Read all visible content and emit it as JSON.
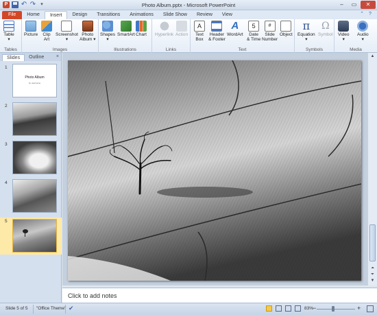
{
  "window": {
    "title": "Photo Album.pptx - Microsoft PowerPoint",
    "app_icon_letter": "P"
  },
  "tabs": [
    "File",
    "Home",
    "Insert",
    "Design",
    "Transitions",
    "Animations",
    "Slide Show",
    "Review",
    "View"
  ],
  "active_tab": "Insert",
  "ribbon": {
    "tables_group": {
      "label": "Tables",
      "table": "Table"
    },
    "images_group": {
      "label": "Images",
      "picture": "Picture",
      "clip_art_1": "Clip",
      "clip_art_2": "Art",
      "screenshot": "Screenshot",
      "photo_album_1": "Photo",
      "photo_album_2": "Album"
    },
    "illustrations_group": {
      "label": "Illustrations",
      "shapes": "Shapes",
      "smartart": "SmartArt",
      "chart": "Chart"
    },
    "links_group": {
      "label": "Links",
      "hyperlink": "Hyperlink",
      "action": "Action"
    },
    "text_group": {
      "label": "Text",
      "text_box_1": "Text",
      "text_box_2": "Box",
      "header_footer_1": "Header",
      "header_footer_2": "& Footer",
      "wordart": "WordArt",
      "date_time_1": "Date",
      "date_time_2": "& Time",
      "slide_number_1": "Slide",
      "slide_number_2": "Number",
      "object": "Object"
    },
    "symbols_group": {
      "label": "Symbols",
      "equation": "Equation",
      "symbol": "Symbol"
    },
    "media_group": {
      "label": "Media",
      "video": "Video",
      "audio": "Audio"
    }
  },
  "left_pane": {
    "tabs": [
      "Slides",
      "Outline"
    ],
    "close": "×",
    "slides": [
      {
        "number": "1",
        "title": "Photo Album",
        "subtitle": "by username"
      },
      {
        "number": "2"
      },
      {
        "number": "3"
      },
      {
        "number": "4"
      },
      {
        "number": "5"
      }
    ],
    "selected_slide": 5
  },
  "notes": {
    "placeholder": "Click to add notes"
  },
  "status": {
    "slide_info": "Slide 5 of 5",
    "theme": "\"Office Theme\"",
    "zoom": "83%",
    "zoom_minus": "−",
    "zoom_plus": "+"
  },
  "colors": {
    "file_tab": "#d24726",
    "selected_slide_bg": "#fde9a8"
  }
}
